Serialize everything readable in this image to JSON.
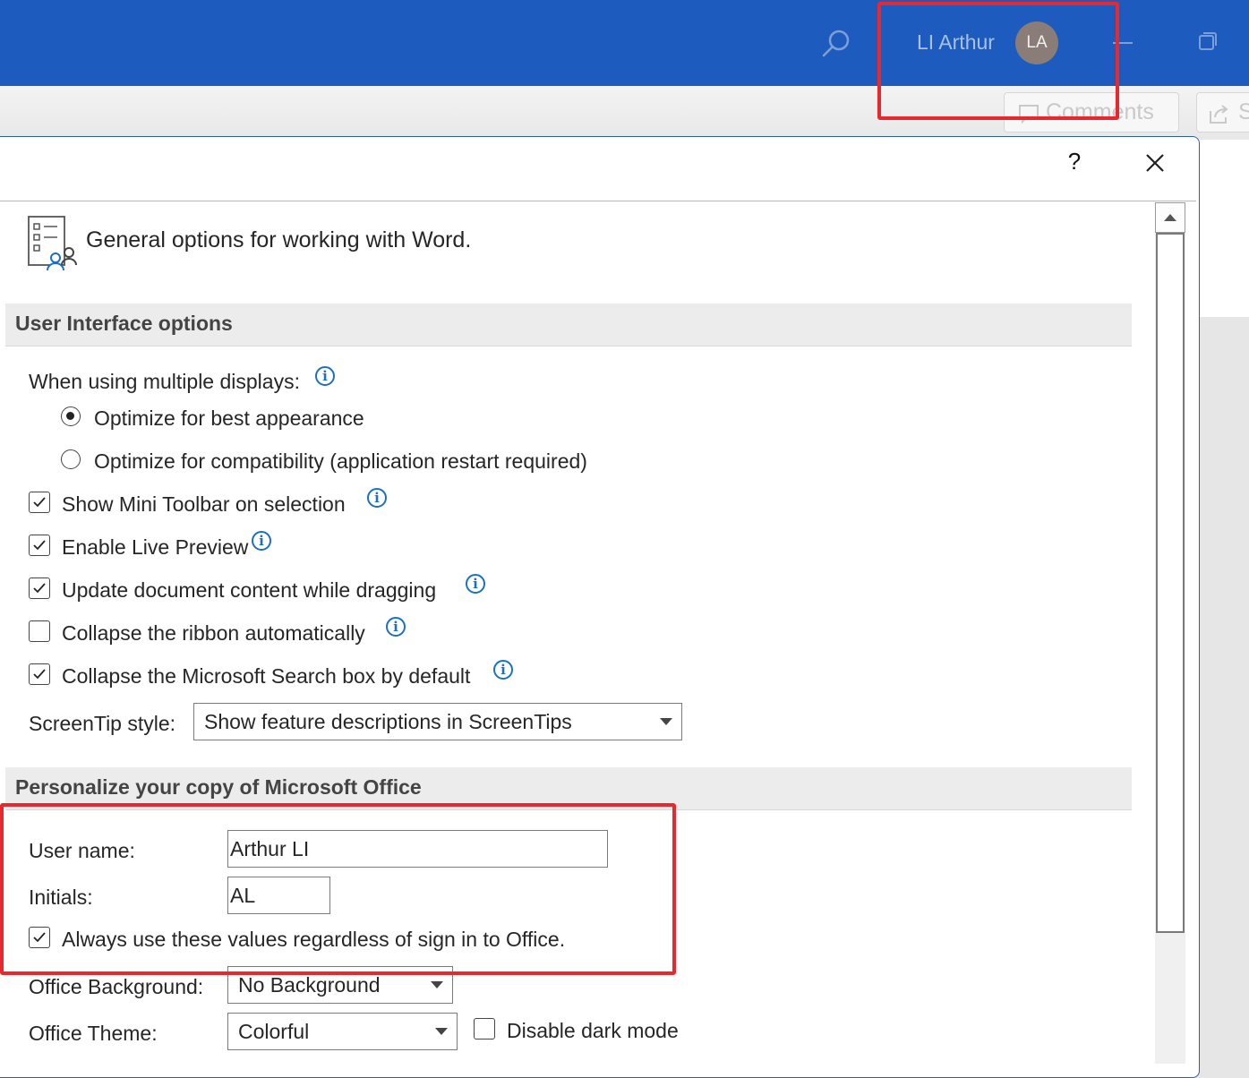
{
  "titlebar": {
    "user_name": "LI Arthur",
    "avatar_initials": "LA",
    "icons": [
      "search-icon",
      "minimize-icon",
      "restore-icon"
    ]
  },
  "ribbon": {
    "comments_label": "Comments",
    "share_label": "S"
  },
  "dialog": {
    "help_label": "?",
    "header_text": "General options for working with Word.",
    "sections": {
      "ui": "User Interface options",
      "personalize": "Personalize your copy of Microsoft Office"
    },
    "multiple_displays_label": "When using multiple displays:",
    "radios": [
      {
        "label": "Optimize for best appearance",
        "selected": true
      },
      {
        "label": "Optimize for compatibility (application restart required)",
        "selected": false
      }
    ],
    "checkboxes": [
      {
        "label": "Show Mini Toolbar on selection",
        "checked": true
      },
      {
        "label": "Enable Live Preview",
        "checked": true
      },
      {
        "label": "Update document content while dragging",
        "checked": true
      },
      {
        "label": "Collapse the ribbon automatically",
        "checked": false
      },
      {
        "label": "Collapse the Microsoft Search box by default",
        "checked": true
      }
    ],
    "screentip": {
      "label": "ScreenTip style:",
      "value": "Show feature descriptions in ScreenTips"
    },
    "user_name": {
      "label": "User name:",
      "value": "Arthur LI"
    },
    "initials": {
      "label": "Initials:",
      "value": "AL"
    },
    "always_use": {
      "label": "Always use these values regardless of sign in to Office.",
      "checked": true
    },
    "office_background": {
      "label": "Office Background:",
      "value": "No Background"
    },
    "office_theme": {
      "label": "Office Theme:",
      "value": "Colorful"
    },
    "disable_dark_mode": {
      "label": "Disable dark mode",
      "checked": false
    }
  },
  "colors": {
    "titlebar": "#1e5bbf",
    "highlight": "#e8282e",
    "info_icon": "#1c6fc3"
  }
}
